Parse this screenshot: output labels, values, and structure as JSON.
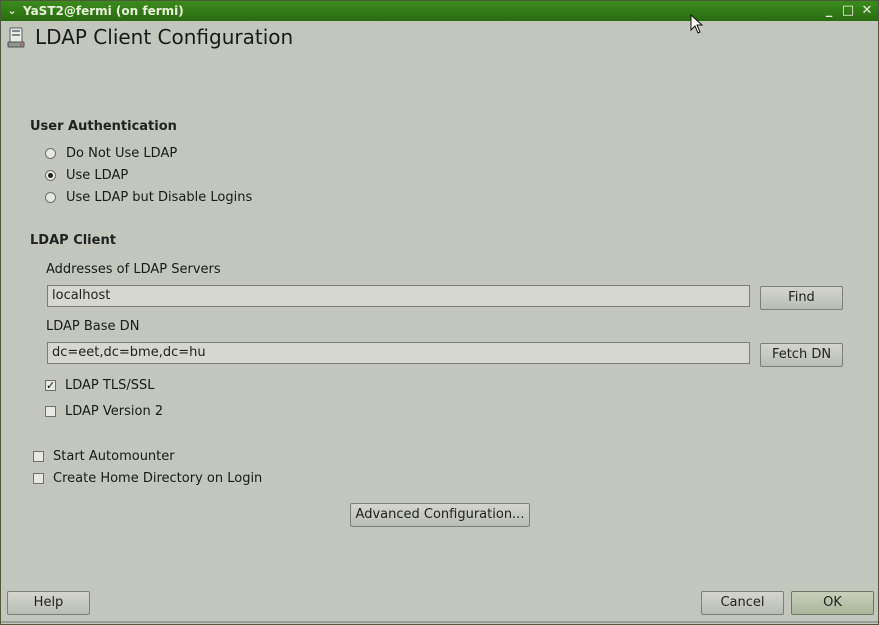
{
  "window": {
    "title": "YaST2@fermi (on fermi)",
    "menu_glyph": "⌄",
    "minimize_glyph": "_",
    "maximize_glyph": "□",
    "close_glyph": "✕"
  },
  "page": {
    "title": "LDAP Client Configuration",
    "icon": "ldap-client-icon"
  },
  "user_auth": {
    "title": "User Authentication",
    "options": [
      {
        "label": "Do Not Use LDAP",
        "selected": false
      },
      {
        "label": "Use LDAP",
        "selected": true
      },
      {
        "label": "Use LDAP but Disable Logins",
        "selected": false
      }
    ]
  },
  "ldap_client": {
    "title": "LDAP Client",
    "servers_label": "Addresses of LDAP Servers",
    "servers_value": "localhost",
    "find_button": "Find",
    "base_dn_label": "LDAP Base DN",
    "base_dn_value": "dc=eet,dc=bme,dc=hu",
    "fetch_dn_button": "Fetch DN",
    "tls_label": "LDAP TLS/SSL",
    "tls_checked": true,
    "version2_label": "LDAP Version 2",
    "version2_checked": false
  },
  "options": {
    "automounter_label": "Start Automounter",
    "automounter_checked": false,
    "home_dir_label": "Create Home Directory on Login",
    "home_dir_checked": false,
    "advanced_button": "Advanced Configuration..."
  },
  "footer": {
    "help_button": "Help",
    "cancel_button": "Cancel",
    "ok_button": "OK"
  }
}
